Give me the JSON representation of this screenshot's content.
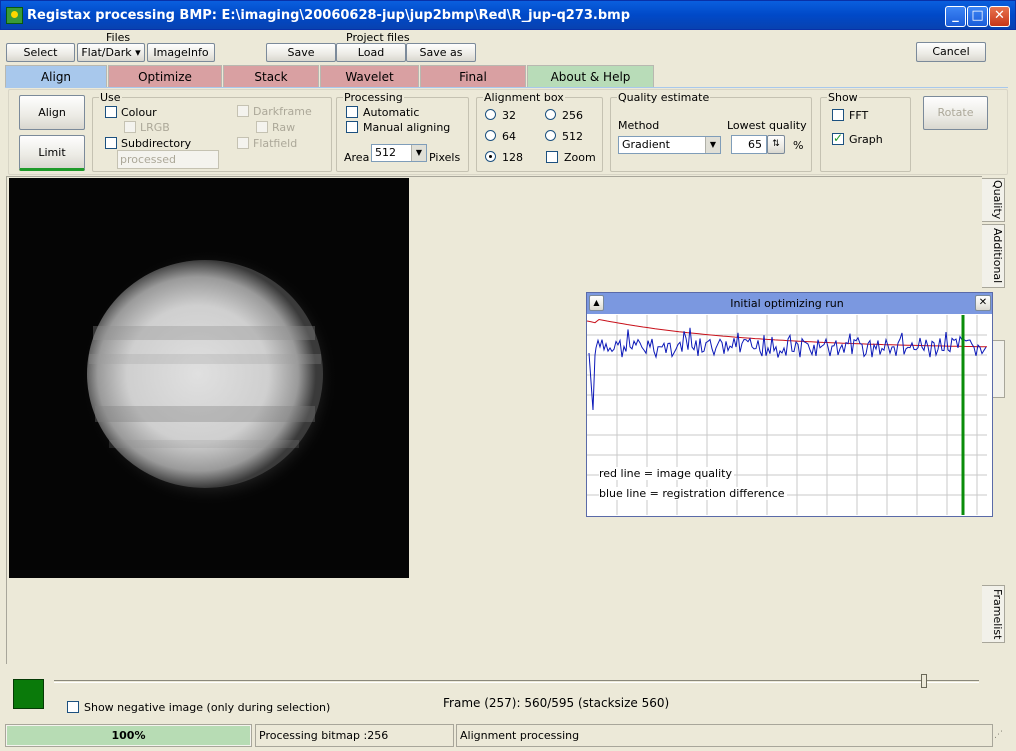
{
  "window": {
    "title": "Registax processing BMP: E:\\imaging\\20060628-jup\\jup2bmp\\Red\\R_jup-q273.bmp",
    "min_label": "_",
    "max_label": "□",
    "close_label": "✕"
  },
  "toolbar": {
    "files_label": "Files",
    "select_label": "Select",
    "flatdark_label": "Flat/Dark ▾",
    "imageinfo_label": "ImageInfo",
    "project_files_label": "Project files",
    "save_label": "Save",
    "load_label": "Load",
    "saveas_label": "Save as",
    "cancel_label": "Cancel"
  },
  "tabs": [
    {
      "label": "Align",
      "color": "#a8c8ec"
    },
    {
      "label": "Optimize",
      "color": "#d9a0a2"
    },
    {
      "label": "Stack",
      "color": "#d9a0a2"
    },
    {
      "label": "Wavelet",
      "color": "#d9a0a2"
    },
    {
      "label": "Final",
      "color": "#d9a0a2"
    },
    {
      "label": "About & Help",
      "color": "#b8dcb8"
    }
  ],
  "align_panel": {
    "align_button": "Align",
    "limit_button": "Limit",
    "use": {
      "title": "Use",
      "colour": "Colour",
      "lrgb": "LRGB",
      "subdirectory": "Subdirectory",
      "subdir_value": "processed",
      "darkframe": "Darkframe",
      "raw": "Raw",
      "flatfield": "Flatfield"
    },
    "processing": {
      "title": "Processing",
      "automatic": "Automatic",
      "manual": "Manual aligning",
      "area_label": "Area",
      "area_value": "512",
      "pixels_label": "Pixels"
    },
    "alignment_box": {
      "title": "Alignment box",
      "opt32": "32",
      "opt64": "64",
      "opt128": "128",
      "opt256": "256",
      "opt512": "512",
      "zoom": "Zoom",
      "selected": "128"
    },
    "quality": {
      "title": "Quality estimate",
      "method_label": "Method",
      "method_value": "Gradient",
      "lowest_label": "Lowest quality",
      "lowest_value": "65",
      "percent": "%"
    },
    "show": {
      "title": "Show",
      "fft": "FFT",
      "graph": "Graph",
      "graph_checked": true
    },
    "rotate_button": "Rotate"
  },
  "sidetabs": {
    "quality": "Quality",
    "additional": "Additional",
    "framelist": "Framelist"
  },
  "graph_window": {
    "title": "Initial optimizing run",
    "legend_red": "red  line = image quality",
    "legend_blue": "blue line = registration difference",
    "colors": {
      "red": "#c8101a",
      "blue": "#0b18b8",
      "green": "#0a8c0a"
    }
  },
  "bottom": {
    "show_negative": "Show negative image (only during selection)",
    "frame_info": "Frame (257): 560/595 (stacksize 560)",
    "slider_fraction": 0.94
  },
  "statusbar": {
    "progress_label": "100%",
    "progress_percent": 100,
    "processing_bitmap": "Processing bitmap :256",
    "alignment_processing": "Alignment processing"
  }
}
